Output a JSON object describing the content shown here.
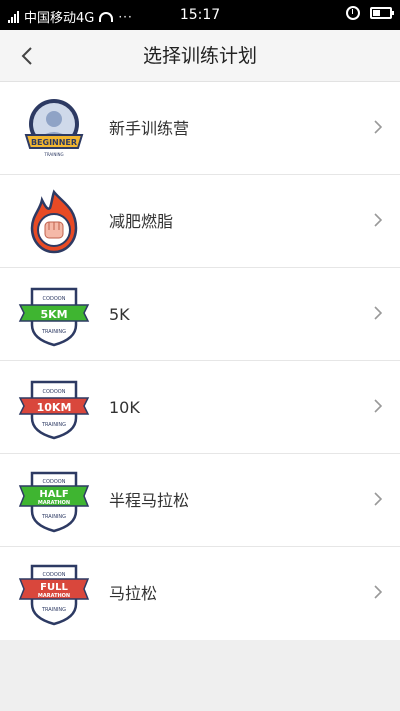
{
  "status_bar": {
    "carrier": "中国移动4G",
    "dots": "···",
    "time": "15:17"
  },
  "header": {
    "title": "选择训练计划"
  },
  "plans": [
    {
      "label": "新手训练营",
      "badge": "beginner-badge-icon",
      "badge_text": "BEGINNER",
      "badge_sub": "TRAINING"
    },
    {
      "label": "减肥燃脂",
      "badge": "fat-burn-fist-icon"
    },
    {
      "label": "5K",
      "badge": "5km-badge-icon",
      "badge_text": "5KM",
      "badge_top": "CODOON",
      "badge_sub": "TRAINING",
      "color": "#3fb531"
    },
    {
      "label": "10K",
      "badge": "10km-badge-icon",
      "badge_text": "10KM",
      "badge_top": "CODOON",
      "badge_sub": "TRAINING",
      "color": "#d9473c"
    },
    {
      "label": "半程马拉松",
      "badge": "half-marathon-badge-icon",
      "badge_text": "HALF",
      "badge_text2": "MARATHON",
      "badge_top": "CODOON",
      "badge_sub": "TRAINING",
      "color": "#3fb531"
    },
    {
      "label": "马拉松",
      "badge": "full-marathon-badge-icon",
      "badge_text": "FULL",
      "badge_text2": "MARATHON",
      "badge_top": "CODOON",
      "badge_sub": "TRAINING",
      "color": "#d9473c"
    }
  ]
}
